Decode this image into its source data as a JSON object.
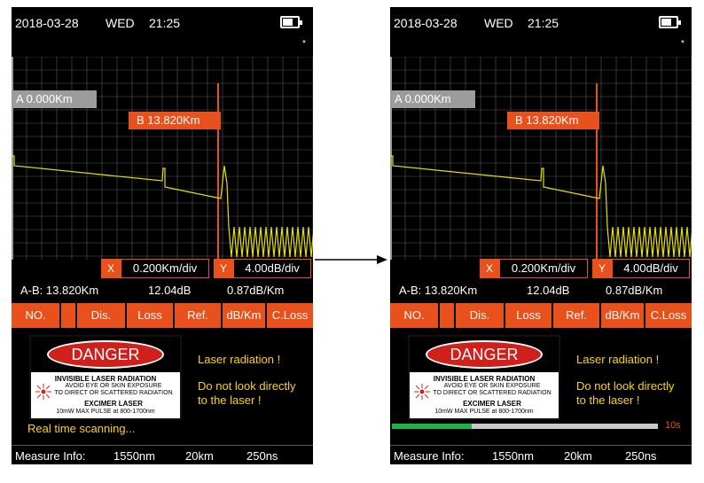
{
  "screens": {
    "left": {
      "status": {
        "date": "2018-03-28",
        "day": "WED",
        "time": "21:25",
        "indicator": "*"
      },
      "marker_a": "A  0.000Km",
      "marker_b": "B  13.820Km",
      "scale": {
        "x_tag": "X",
        "x_value": "0.200Km/div",
        "y_tag": "Y",
        "y_value": "4.00dB/div"
      },
      "ab": {
        "distance": "A-B: 13.820Km",
        "loss": "12.04dB",
        "attenuation": "0.87dB/Km"
      },
      "tabs": [
        "NO.",
        "",
        "Dis.",
        "Loss",
        "Ref.",
        "dB/Km",
        "C.Loss"
      ],
      "danger": {
        "title": "DANGER",
        "line1": "INVISIBLE LASER RADIATION",
        "line2": "AVOID EYE OR SKIN EXPOSURE",
        "line3": "TO DIRECT OR SCATTERED RADIATION",
        "line4": "EXCIMER LASER",
        "line5": "10mW MAX PULSE at 800-1700nm"
      },
      "warnings": {
        "w1": "Laser radiation !",
        "w2": "Do not look directly",
        "w3": "to the laser !"
      },
      "scanning": "Real time scanning...",
      "measure": {
        "label": "Measure Info:",
        "wavelength": "1550nm",
        "range": "20km",
        "pulse": "250ns"
      }
    },
    "right": {
      "status": {
        "date": "2018-03-28",
        "day": "WED",
        "time": "21:25",
        "indicator": "*"
      },
      "marker_a": "A  0.000Km",
      "marker_b": "B  13.820Km",
      "scale": {
        "x_tag": "X",
        "x_value": "0.200Km/div",
        "y_tag": "Y",
        "y_value": "4.00dB/div"
      },
      "ab": {
        "distance": "A-B: 13.820Km",
        "loss": "12.04dB",
        "attenuation": "0.87dB/Km"
      },
      "tabs": [
        "NO.",
        "",
        "Dis.",
        "Loss",
        "Ref.",
        "dB/Km",
        "C.Loss"
      ],
      "danger": {
        "title": "DANGER",
        "line1": "INVISIBLE LASER RADIATION",
        "line2": "AVOID EYE OR SKIN EXPOSURE",
        "line3": "TO DIRECT OR SCATTERED RADIATION",
        "line4": "EXCIMER LASER",
        "line5": "10mW MAX PULSE at 800-1700nm"
      },
      "warnings": {
        "w1": "Laser radiation !",
        "w2": "Do not look directly",
        "w3": "to the laser !"
      },
      "progress": {
        "fraction": 0.3,
        "label": "10s"
      },
      "measure": {
        "label": "Measure Info:",
        "wavelength": "1550nm",
        "range": "20km",
        "pulse": "250ns"
      }
    }
  },
  "colors": {
    "accent": "#e8501c",
    "trace": "#e6e000",
    "warning_text": "#ffd400",
    "progress": "#1eb24a",
    "background": "#000000"
  },
  "icons": {
    "battery": "battery-icon",
    "arrow": "arrow-right-icon",
    "laser": "laser-hazard-icon"
  }
}
